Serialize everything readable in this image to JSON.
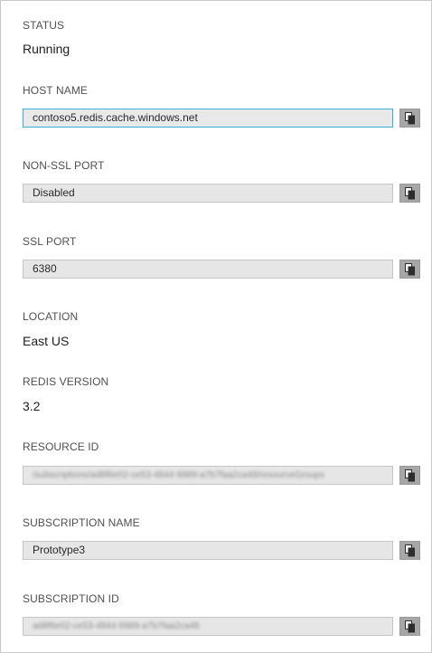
{
  "properties": {
    "status": {
      "label": "STATUS",
      "value": "Running"
    },
    "host_name": {
      "label": "HOST NAME",
      "value": "contoso5.redis.cache.windows.net"
    },
    "non_ssl_port": {
      "label": "NON-SSL PORT",
      "value": "Disabled"
    },
    "ssl_port": {
      "label": "SSL PORT",
      "value": "6380"
    },
    "location": {
      "label": "LOCATION",
      "value": "East US"
    },
    "redis_version": {
      "label": "REDIS VERSION",
      "value": "3.2"
    },
    "resource_id": {
      "label": "RESOURCE ID",
      "value": "/subscriptions/ad8f6e02-ce53-4844-9989-a7b7faa2ca48/resourceGroups"
    },
    "subscription_name": {
      "label": "SUBSCRIPTION NAME",
      "value": "Prototype3"
    },
    "subscription_id": {
      "label": "SUBSCRIPTION ID",
      "value": "ad8f6e02-ce53-4844-9989-a7b7faa2ca48"
    }
  },
  "icons": {
    "copy": "copy-icon"
  },
  "colors": {
    "field_background": "#e6e6e6",
    "focus_border": "#3ab0d6",
    "copy_button": "#a7a7a7"
  }
}
